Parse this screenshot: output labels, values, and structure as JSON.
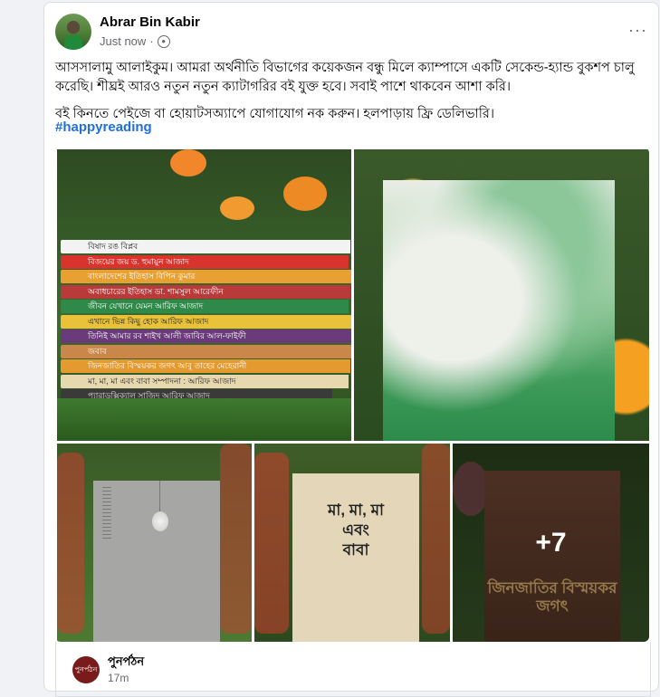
{
  "post": {
    "author": "Abrar Bin Kabir",
    "time": "Just now",
    "audience_separator": "·",
    "menu_glyph": "···",
    "paragraph1": "আসসালামু আলাইকুম। আমরা অর্থনীতি বিভাগের কয়েকজন বন্ধু মিলে ক্যাম্পাসে একটি সেকেন্ড-হ্যান্ড বুকশপ চালু করেছি। শীঘ্রই আরও নতুন নতুন ক্যাটাগরির বই যুক্ত হবে। সবাই পাশে থাকবেন আশা করি।",
    "paragraph2": "বই কিনতে পেইজে বা হোয়াটসঅ্যাপে যোগাযোগ নক করুন। হলপাড়ায় ফ্রি ডেলিভারি।",
    "hashtag": "#happyreading"
  },
  "photos": {
    "book_spines": [
      "বিষাদ রঙ বিপ্লব",
      "বিজয়ের জয়    ড. হুমায়ুন আজাদ",
      "বাংলাদেশের ইতিহাস     বিপিন কুমার",
      "অবাধচারের ইতিহাস    ডা. শামসুল আরেফীন",
      "জীবন যেখানে যেমন    আরিফ আজাদ",
      "এখানে ভিন্ন কিছু হোক    আরিফ আজাদ",
      "তিনিই আমার রব    শাইখ আলী জাবির আল-ফাইফী",
      "জবাব",
      "জিনজাতির বিস্ময়কর জগৎ    আবু তাহের মেহেরানী",
      "মা, মা, মা এবং বাবা    সম্পাদনা : আরিফ আজাদ",
      "প্যারাডক্সিক্যাল সাজিদ    আরিফ আজাদ"
    ],
    "cream_book_title": "মা, মা, মা\nএবং\nবাবা",
    "brown_book_title": "জিনজাতির বিস্ময়কর জগৎ",
    "more_count": "+7"
  },
  "shared": {
    "page_name": "পুনর্পঠন",
    "logo_text": "পুনর্পঠন",
    "time": "17m"
  },
  "colors": {
    "hashtag": "#216fdb",
    "spines": [
      "#f3f3f3",
      "#d8342d",
      "#e8a032",
      "#b83a3a",
      "#2f8a4a",
      "#e9c23a",
      "#6b3a7a",
      "#c9874a",
      "#e49a2e",
      "#e8d8b0",
      "#3a3a3a"
    ]
  }
}
